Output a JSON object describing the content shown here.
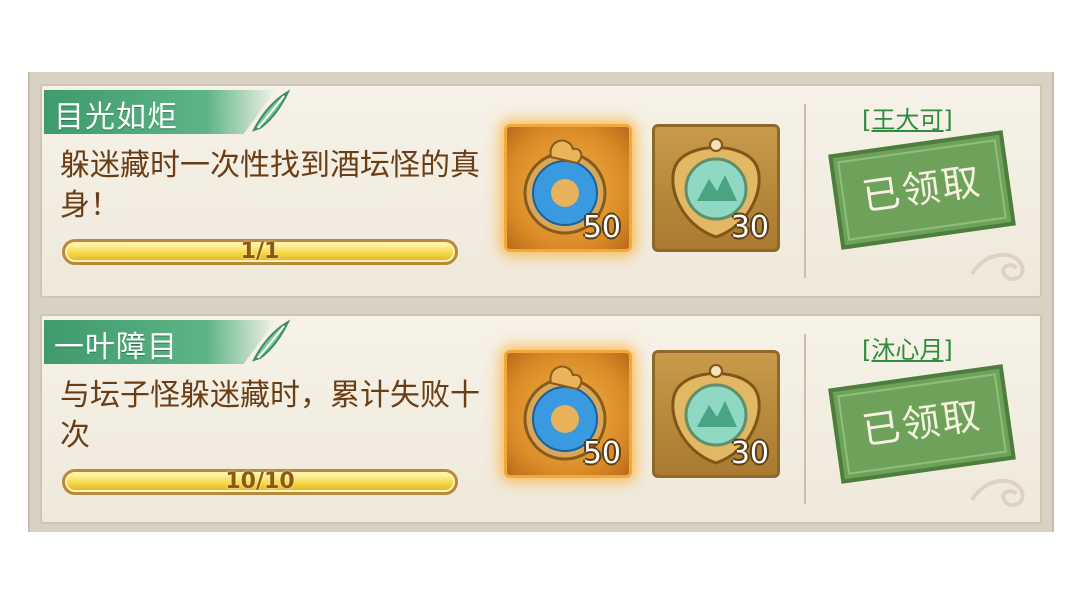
{
  "achievements": [
    {
      "title": "目光如炬",
      "description": "躲迷藏时一次性找到酒坛怪的真身！",
      "progress_text": "1/1",
      "progress_fraction": 1.0,
      "rewards": [
        {
          "icon": "jade-ring-icon",
          "count": "50"
        },
        {
          "icon": "jade-medallion-icon",
          "count": "30"
        }
      ],
      "player_name": "[王大可]",
      "status_label": "已领取"
    },
    {
      "title": "一叶障目",
      "description": "与坛子怪躲迷藏时，累计失败十次",
      "progress_text": "10/10",
      "progress_fraction": 1.0,
      "rewards": [
        {
          "icon": "jade-ring-icon",
          "count": "50"
        },
        {
          "icon": "jade-medallion-icon",
          "count": "30"
        }
      ],
      "player_name": "[沐心月]",
      "status_label": "已领取"
    }
  ],
  "colors": {
    "title_tag": "#4fa876",
    "description_text": "#6b3d14",
    "player_name": "#2e8c3c",
    "stamp": "#6ea15a",
    "progress_fill": "#f7d84c"
  }
}
